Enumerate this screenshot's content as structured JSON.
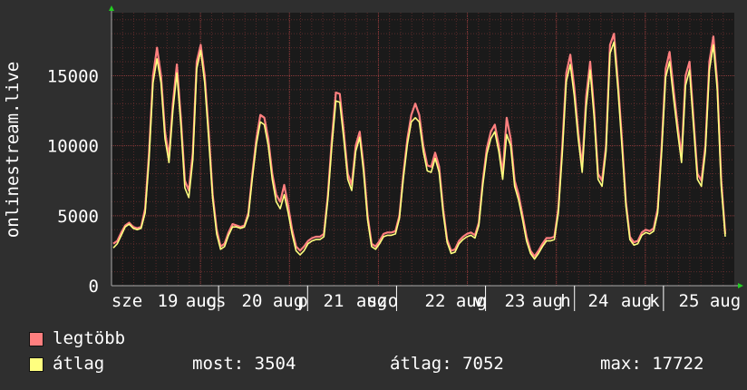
{
  "chart_data": {
    "type": "area",
    "ylabel": "onlinestream.live",
    "y_ticks": [
      0,
      5000,
      10000,
      15000
    ],
    "ylim": [
      0,
      19500
    ],
    "x_tick_labels": [
      "sze",
      "19",
      "aug",
      "cs",
      "20",
      "aug",
      "p",
      "21",
      "aug",
      "szo",
      "22",
      "aug",
      "v",
      "23",
      "aug",
      "h",
      "24",
      "aug",
      "k",
      "25",
      "aug"
    ],
    "series": [
      {
        "name": "legtöbb",
        "color": "#ff7f7f",
        "values": [
          3000,
          3200,
          3800,
          4300,
          4500,
          4200,
          4100,
          4200,
          5500,
          9500,
          15000,
          17000,
          15000,
          11000,
          9200,
          13000,
          15800,
          12000,
          7500,
          6800,
          9500,
          16000,
          17200,
          15000,
          11000,
          6500,
          4000,
          2800,
          3000,
          3800,
          4400,
          4300,
          4200,
          4300,
          5200,
          8000,
          10500,
          12200,
          12000,
          10500,
          8000,
          6500,
          6000,
          7200,
          5700,
          4000,
          2800,
          2500,
          2800,
          3200,
          3400,
          3500,
          3500,
          3700,
          6500,
          10500,
          13800,
          13700,
          11000,
          8000,
          7200,
          10000,
          11000,
          8500,
          5000,
          3000,
          2800,
          3200,
          3700,
          3800,
          3800,
          3900,
          5000,
          8000,
          10500,
          12200,
          13000,
          12200,
          10000,
          8600,
          8500,
          9500,
          8500,
          5500,
          3300,
          2500,
          2600,
          3200,
          3500,
          3700,
          3800,
          3600,
          4500,
          7500,
          9800,
          11000,
          11500,
          10000,
          8000,
          12000,
          10500,
          7500,
          6500,
          5000,
          3500,
          2500,
          2100,
          2500,
          3000,
          3400,
          3400,
          3500,
          5500,
          10000,
          15200,
          16500,
          14200,
          11000,
          8500,
          13500,
          16000,
          12500,
          8000,
          7500,
          10000,
          17200,
          18000,
          14500,
          10500,
          6000,
          3500,
          3100,
          3200,
          3800,
          4000,
          3900,
          4100,
          5500,
          10000,
          15500,
          16700,
          14000,
          11500,
          9200,
          15000,
          16000,
          12000,
          8000,
          7500,
          10000,
          16000,
          17800,
          14500,
          7500,
          3700
        ]
      },
      {
        "name": "átlag",
        "color": "#ffff7f",
        "values": [
          2700,
          3000,
          3600,
          4200,
          4400,
          4100,
          4000,
          4100,
          5200,
          9000,
          14500,
          16200,
          14500,
          10500,
          8800,
          12500,
          15200,
          11500,
          7000,
          6300,
          9000,
          15500,
          16800,
          14500,
          10500,
          6200,
          3700,
          2600,
          2800,
          3600,
          4200,
          4200,
          4100,
          4200,
          5000,
          7700,
          10100,
          11700,
          11500,
          10000,
          7600,
          6000,
          5500,
          6500,
          5200,
          3700,
          2500,
          2200,
          2500,
          3000,
          3200,
          3300,
          3300,
          3500,
          6200,
          10000,
          13200,
          13100,
          10500,
          7600,
          6800,
          9600,
          10600,
          8100,
          4700,
          2800,
          2600,
          3000,
          3500,
          3600,
          3600,
          3700,
          4800,
          7700,
          10100,
          11700,
          12000,
          11700,
          9600,
          8200,
          8100,
          9100,
          8100,
          5200,
          3100,
          2300,
          2400,
          3000,
          3300,
          3500,
          3600,
          3400,
          4300,
          7200,
          9400,
          10500,
          11000,
          9600,
          7600,
          10800,
          10000,
          7100,
          6100,
          4700,
          3200,
          2300,
          1900,
          2300,
          2800,
          3200,
          3200,
          3300,
          5200,
          9500,
          14600,
          15800,
          13600,
          10500,
          8100,
          12800,
          15400,
          12000,
          7600,
          7100,
          9600,
          16600,
          17400,
          14000,
          10000,
          5700,
          3300,
          2900,
          3000,
          3600,
          3800,
          3700,
          3900,
          5200,
          9600,
          14900,
          16000,
          13400,
          11000,
          8800,
          14300,
          15400,
          11500,
          7600,
          7100,
          9600,
          15400,
          17200,
          14000,
          7100,
          3504
        ]
      }
    ]
  },
  "legend": [
    {
      "label": "legtöbb",
      "color": "#ff7f7f"
    },
    {
      "label": "átlag",
      "color": "#ffff7f"
    }
  ],
  "stats": {
    "most": "most: 3504",
    "atlag": "átlag: 7052",
    "max": "max: 17722"
  }
}
